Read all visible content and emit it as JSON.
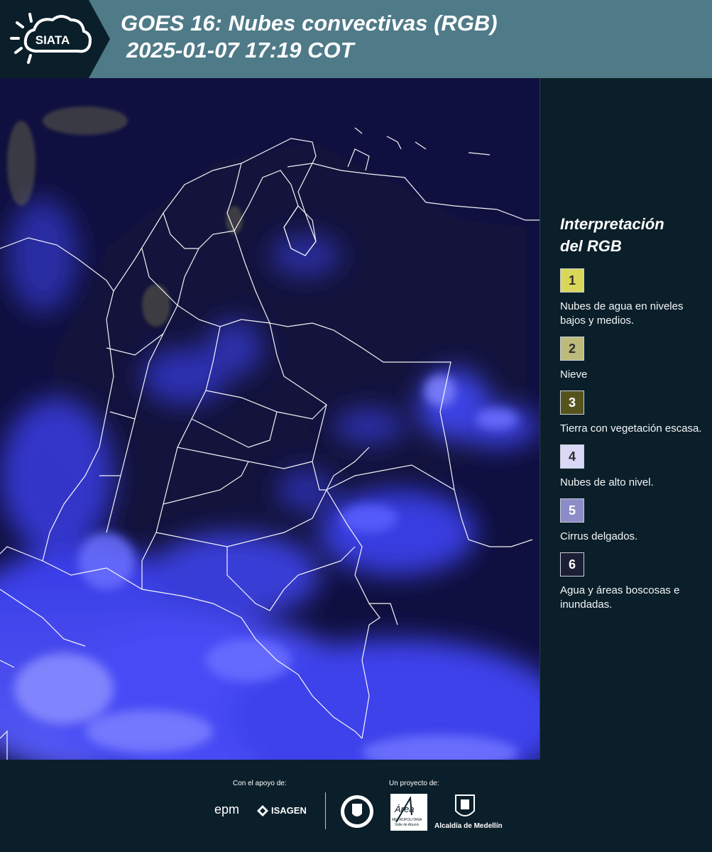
{
  "header": {
    "logo_text": "SIATA",
    "title_line1": "GOES 16: Nubes convectivas (RGB)",
    "title_line2": "2025-01-07 17:19 COT"
  },
  "map": {
    "imagery": "GOES-16 convective clouds RGB satellite composite over Colombia with department borders",
    "background_color": "#0e0f3a",
    "cloud_color": "#4a50ff",
    "border_color": "#ffffff"
  },
  "legend": {
    "title_line1": "Interpretación",
    "title_line2": "del RGB",
    "items": [
      {
        "number": "1",
        "color": "#d9d75a",
        "label": "Nubes de agua en niveles bajos y medios."
      },
      {
        "number": "2",
        "color": "#bdbb7c",
        "label": "Nieve"
      },
      {
        "number": "3",
        "color": "#55531c",
        "label": "Tierra con vegetación escasa."
      },
      {
        "number": "4",
        "color": "#d9d9f7",
        "label": "Nubes de alto nivel."
      },
      {
        "number": "5",
        "color": "#8c8cc8",
        "label": "Cirrus delgados."
      },
      {
        "number": "6",
        "color": "#1b1e35",
        "label": "Agua y áreas boscosas e inundadas."
      }
    ]
  },
  "footer": {
    "support_label": "Con el apoyo de:",
    "project_label": "Un proyecto de:",
    "sponsor_epm": "epm",
    "sponsor_isagen": "ISAGEN",
    "area_text": "Área",
    "area_sub": "METROPOLITANA",
    "area_sub2": "Valle de Aburrá",
    "alcaldia": "Alcaldía de Medellín"
  }
}
